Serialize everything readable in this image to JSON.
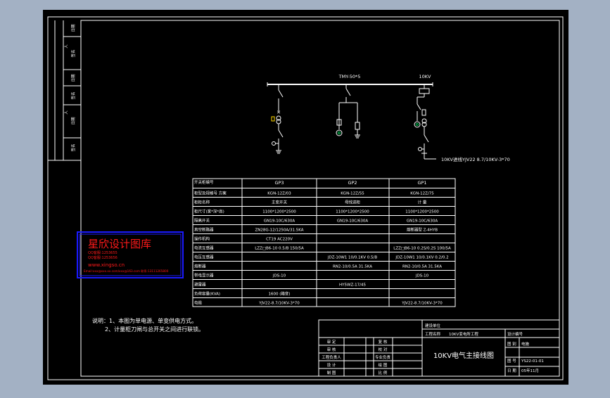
{
  "side_strip": {
    "labels": [
      "日期",
      "签名",
      "人",
      "日期",
      "签名",
      "人",
      "日期",
      "签名"
    ]
  },
  "bus": {
    "label_left": "TMY-50*5",
    "label_right": "10KV"
  },
  "incoming_cable": "10KV进线YJV22 8.7/10KV-3*70",
  "table": {
    "header_label": "开关柜编号",
    "columns": [
      "GP3",
      "GP2",
      "GP1"
    ],
    "rows": [
      {
        "label": "柜型及规格号 方案",
        "cells": [
          "KGN-12Z/03",
          "KGN-12Z/55",
          "KGN-12Z/75"
        ]
      },
      {
        "label": "柜柜名称",
        "cells": [
          "主变开关",
          "母线进柜",
          "计 量"
        ]
      },
      {
        "label": "柜尺寸(宽*深*高)",
        "cells": [
          "1100*1200*2500",
          "1100*1200*2500",
          "1100*1200*2500"
        ]
      },
      {
        "label": "隔离开关",
        "cells": [
          "GN19-10C/630A",
          "GN19-10C/630A",
          "GN19-10C/630A"
        ]
      },
      {
        "label": "真空断路器",
        "cells": [
          "ZN28G-12/1250A/31.5KA",
          "",
          "熔断器型 Z-4HYB"
        ]
      },
      {
        "label": "操作机构",
        "cells": [
          "CT19 AC220V",
          "",
          ""
        ]
      },
      {
        "label": "电流互感器",
        "cells": [
          "LZZ□B6-10 0.5/B 150/5A",
          "",
          "LZZ□B6-10 0.2S/0.2S 100/5A"
        ]
      },
      {
        "label": "电压互感器",
        "cells": [
          "",
          "JDZ-10W1 10/0.1KV 0.5/B",
          "JDZ-10W1 10/0.1KV 0.2/0.2"
        ]
      },
      {
        "label": "熔断器",
        "cells": [
          "",
          "RN2-10/0.5A 31.5KA",
          "RN2-10/0.5A 31.5KA"
        ]
      },
      {
        "label": "带电显示器",
        "cells": [
          "JDS-10",
          "",
          "JDS-10"
        ]
      },
      {
        "label": "避雷器",
        "cells": [
          "",
          "HY5WZ-17/45",
          ""
        ]
      },
      {
        "label": "负荷容量(KVA)",
        "cells": [
          "1600 (箱变)",
          "",
          ""
        ]
      },
      {
        "label": "电缆",
        "cells": [
          "YJV22-8.7/10KV-3*70",
          "",
          "YJV22-8.7/10KV-3*70"
        ]
      }
    ]
  },
  "notes": {
    "line1": "说明：1、本图为单电源、单变供电方式。",
    "line2": "2、计量柜刀闸与总开关之间进行联锁。"
  },
  "watermark": {
    "title": "星欣设计图库",
    "line1": "QQ客服:1253655",
    "line2": "QQ客服:1253656",
    "url": "www.xingso.cn",
    "email": "Email:xxx@xxx.xx.com/xxx@163.com 联系:13111265800"
  },
  "title_block": {
    "org_label": "建设单位",
    "project_label": "工程名称",
    "project_value": "10KV变电所工程",
    "design_no_label": "设计编号",
    "drawing_name": "10KV电气主接线图",
    "drawing_label": "图 别",
    "drawing_value": "电施",
    "number_label": "图 号",
    "number_value": "YS22-01-01",
    "date_label": "日 期",
    "date_value": "05年11月",
    "sign_rows": [
      [
        "审 定",
        "",
        "复 核",
        ""
      ],
      [
        "审 核",
        "",
        "校 对",
        ""
      ],
      [
        "工程负责人",
        "",
        "专业负责",
        ""
      ],
      [
        "设 计",
        "",
        "绘 图",
        ""
      ],
      [
        "制 图",
        "",
        "比 例",
        ""
      ]
    ]
  },
  "colors": {
    "background": "#a3b1c4",
    "drawing": "#000000",
    "lines": "#ffffff",
    "watermark": "#ff1a1a",
    "watermark_border": "#1a1aff",
    "accent_yellow": "#ffd800",
    "accent_green": "#00c853"
  }
}
